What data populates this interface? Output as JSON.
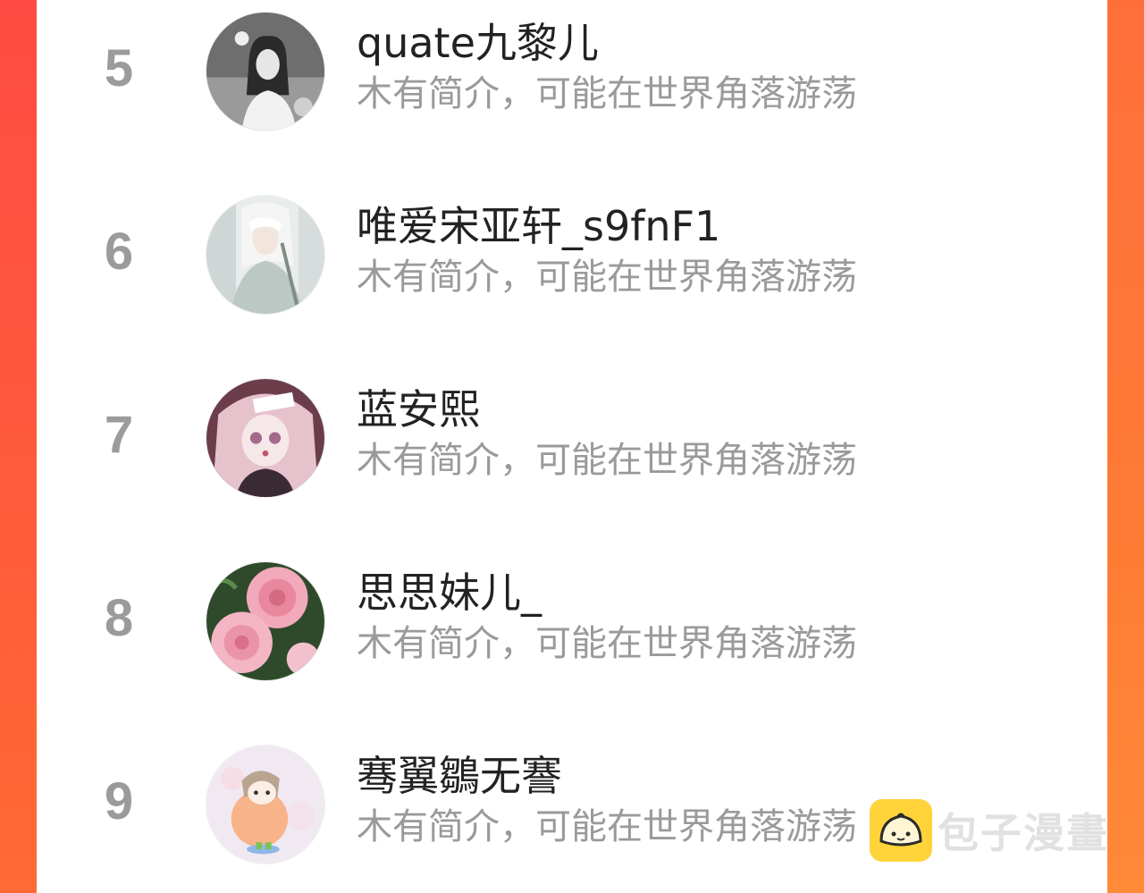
{
  "colors": {
    "left_bar": "#ff4b43",
    "right_bar": "#ff7b35",
    "rank": "#9b9b9b",
    "name": "#222222",
    "bio": "#9a9a9a",
    "watermark_icon": "#ffd43b"
  },
  "rankings": [
    {
      "rank": "5",
      "name": "quate九黎儿",
      "bio": "木有简介，可能在世界角落游荡",
      "avatar": "avatar-grayscale-girl-icon"
    },
    {
      "rank": "6",
      "name": "唯爱宋亚轩_s9fnF1",
      "bio": "木有简介，可能在世界角落游荡",
      "avatar": "avatar-anime-swordsman-icon"
    },
    {
      "rank": "7",
      "name": "蓝安熙",
      "bio": "木有简介，可能在世界角落游荡",
      "avatar": "avatar-anime-pink-girl-icon"
    },
    {
      "rank": "8",
      "name": "思思妹儿_",
      "bio": "木有简介，可能在世界角落游荡",
      "avatar": "avatar-pink-roses-icon"
    },
    {
      "rank": "9",
      "name": "骞翼鶵无謇",
      "bio": "木有简介，可能在世界角落游荡",
      "avatar": "avatar-cartoon-peach-boy-icon"
    }
  ],
  "watermark": {
    "text": "包子漫畫",
    "icon": "bun-mascot-icon"
  }
}
